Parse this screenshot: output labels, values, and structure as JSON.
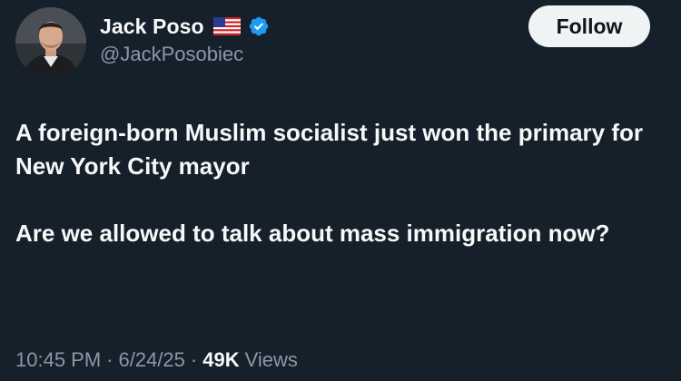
{
  "author": {
    "display_name": "Jack Poso",
    "handle": "@JackPosobiec",
    "flag_icon": "us-flag-icon",
    "verified_icon": "verified-badge-icon",
    "verified_color": "#1d9bf0"
  },
  "follow_button": {
    "label": "Follow"
  },
  "tweet": {
    "paragraphs": [
      "A foreign-born Muslim socialist just won the primary for New York City mayor",
      "Are we allowed to talk about mass immigration now?"
    ]
  },
  "meta": {
    "time": "10:45 PM",
    "date": "6/24/25",
    "separator": "·",
    "views_count": "49K",
    "views_label": "Views"
  },
  "colors": {
    "background": "#15202b",
    "primary_text": "#f7f9f9",
    "secondary_text": "#8b98a5",
    "button_bg": "#eff3f4"
  }
}
